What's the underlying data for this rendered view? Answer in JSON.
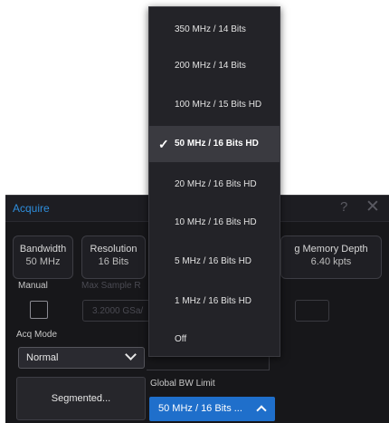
{
  "panel": {
    "title": "Acquire",
    "help": "?",
    "close": "✕"
  },
  "info_boxes": [
    {
      "label": "Bandwidth",
      "value": "50 MHz"
    },
    {
      "label": "Resolution",
      "value": "16 Bits"
    },
    {
      "label": "g Memory Depth",
      "value": "6.40 kpts"
    }
  ],
  "manual_label": "Manual",
  "max_sample_label": "Max Sample R",
  "max_sample_value": "3.2000 GSa/",
  "acq_mode": {
    "label": "Acq Mode",
    "value": "Normal"
  },
  "segmented_label": "Segmented...",
  "global_bw": {
    "label": "Global BW Limit",
    "value": "50 MHz / 16 Bits ..."
  },
  "dropdown": {
    "items": [
      "350 MHz / 14 Bits",
      "200 MHz / 14 Bits",
      "100 MHz / 15 Bits HD",
      "50 MHz / 16 Bits HD",
      "20 MHz / 16 Bits HD",
      "10 MHz / 16 Bits HD",
      "5 MHz / 16 Bits HD",
      "1 MHz / 16 Bits HD",
      "Off"
    ],
    "selected_index": 3,
    "check": "✓"
  },
  "colors": {
    "accent": "#1f6fcb",
    "title": "#2e8ddb",
    "panel_bg": "#17171a",
    "dropdown_bg": "#232328"
  }
}
